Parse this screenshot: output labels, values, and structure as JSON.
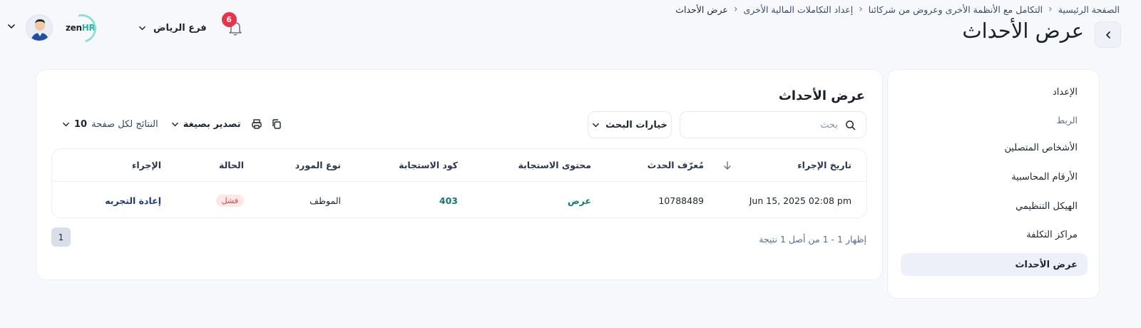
{
  "breadcrumb": {
    "items": [
      "الصفحة الرئيسية",
      "التكامل مع الأنظمة الأخرى وعروض من شركائنا",
      "إعداد التكاملات المالية الأخرى"
    ],
    "current": "عرض الأحداث"
  },
  "page_title": "عرض الأحداث",
  "topbar": {
    "branch_label": "فرع الرياض",
    "notification_count": "6",
    "logo_text_zen": "zen",
    "logo_text_hr": "HR"
  },
  "sidebar": {
    "items": [
      {
        "label": "الإعداد"
      },
      {
        "label": "الربط"
      },
      {
        "label": "الأشخاص المتصلين"
      },
      {
        "label": "الأرقام المحاسبية"
      },
      {
        "label": "الهيكل التنظيمي"
      },
      {
        "label": "مراكز التكلفة"
      },
      {
        "label": "عرض الأحداث"
      }
    ]
  },
  "card": {
    "title": "عرض الأحداث",
    "search_placeholder": "بحث",
    "search_options_label": "خيارات البحث",
    "export_label": "تصدير بصيغة",
    "per_page_label": "النتائج لكل صفحة",
    "per_page_value": "10"
  },
  "table": {
    "columns": [
      "تاريخ الإجراء",
      "مُعرّف الحدث",
      "محتوى الاستجابة",
      "كود الاستجابة",
      "نوع المورد",
      "الحالة",
      "الإجراء"
    ],
    "rows": [
      {
        "date": "Jun 15, 2025 02:08 pm",
        "event_id": "10788489",
        "response_content": "عرض",
        "response_code": "403",
        "resource_type": "الموظف",
        "status": "فشل",
        "action": "إعادة التجربه"
      }
    ]
  },
  "pagination": {
    "summary": "إظهار 1 - 1 من أصل 1 نتيجة",
    "current_page": "1"
  },
  "colors": {
    "accent_link": "#157a6e",
    "badge_fail_bg": "#fde7e7",
    "badge_fail_text": "#d24b4b",
    "notification_badge": "#e8334a"
  }
}
